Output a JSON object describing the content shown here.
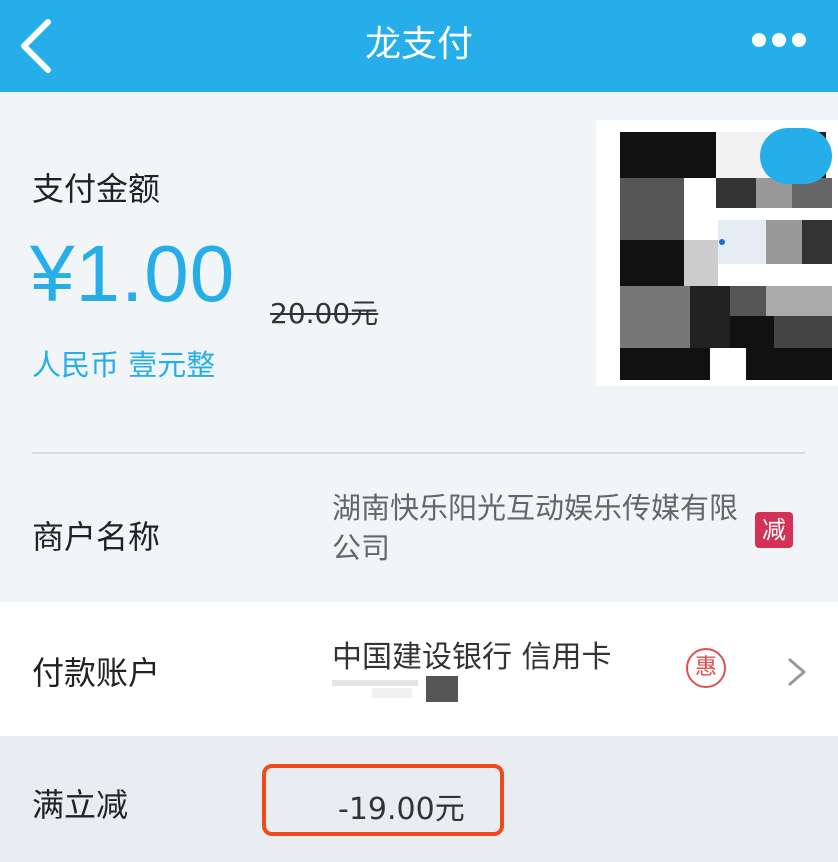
{
  "header": {
    "title": "龙支付",
    "back_icon": "chevron-left-icon",
    "more_icon": "more-dots-icon"
  },
  "payment": {
    "amount_label": "支付金额",
    "amount": "¥1.00",
    "original_price": "20.00元",
    "amount_in_words": "人民币 壹元整"
  },
  "merchant": {
    "label": "商户名称",
    "name": "湖南快乐阳光互动娱乐传媒有限公司",
    "discount_badge": "减"
  },
  "payment_account": {
    "label": "付款账户",
    "account": "中国建设银行 信用卡",
    "benefit_badge": "惠"
  },
  "promotion": {
    "label": "满立减",
    "value": "-19.00元"
  },
  "colors": {
    "brand_blue": "#25aee9",
    "highlight_red": "#f04a1a",
    "badge_red": "#d33256"
  }
}
